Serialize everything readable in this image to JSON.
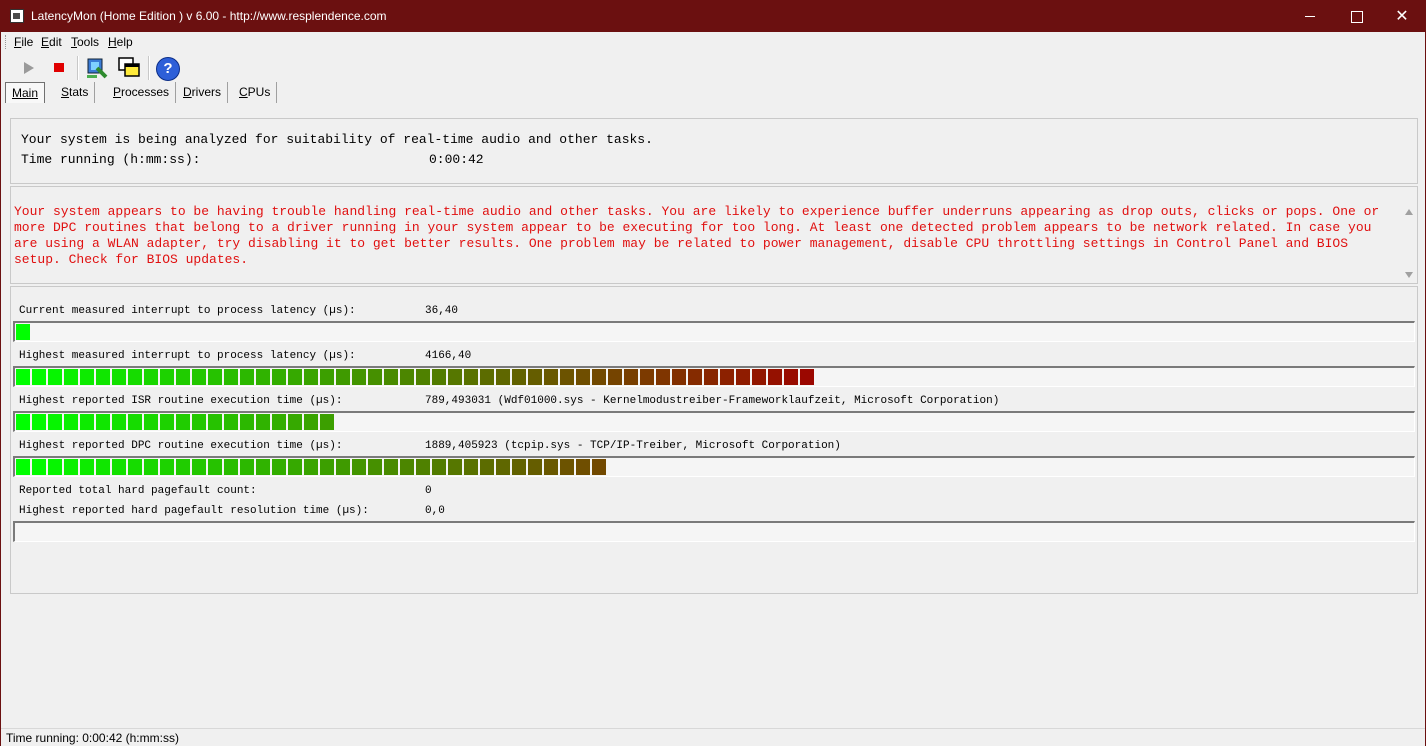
{
  "window": {
    "title": "LatencyMon  (Home Edition )  v 6.00 - http://www.resplendence.com"
  },
  "menu": [
    {
      "label": "File",
      "accel": "F",
      "rest": "ile"
    },
    {
      "label": "Edit",
      "accel": "E",
      "rest": "dit"
    },
    {
      "label": "Tools",
      "accel": "T",
      "rest": "ools"
    },
    {
      "label": "Help",
      "accel": "H",
      "rest": "elp"
    }
  ],
  "toolbar": {
    "icons": [
      "play-icon",
      "stop-icon",
      "cpu-icon",
      "windows-icon",
      "help-icon"
    ]
  },
  "tabs": [
    {
      "label": "Main",
      "accel": "M",
      "rest": "ain",
      "active": true
    },
    {
      "label": "Stats",
      "accel": "S",
      "rest": "tats",
      "active": false
    },
    {
      "label": "Processes",
      "accel": "P",
      "rest": "rocesses",
      "active": false
    },
    {
      "label": "Drivers",
      "accel": "D",
      "rest": "rivers",
      "active": false
    },
    {
      "label": "CPUs",
      "accel": "C",
      "rest": "PUs",
      "active": false
    }
  ],
  "status": {
    "analyzing": "Your system is being analyzed for suitability of real-time audio and other tasks.",
    "time_label": "Time running (h:mm:ss):",
    "time_value": "0:00:42"
  },
  "warning": {
    "text": "Your system appears to be having trouble handling real-time audio and other tasks. You are likely to experience buffer underruns appearing as drop outs, clicks or pops. One or more DPC routines that belong to a driver running in your system appear to be executing for too long. At least one detected problem appears to be network related. In case you are using a WLAN adapter, try disabling it to get better results. One problem may be related to power management, disable CPU throttling settings in Control Panel and BIOS setup. Check for BIOS updates.",
    "color": "#e01010"
  },
  "metrics": {
    "current": {
      "label": "Current measured interrupt to process latency (µs):",
      "value": "36,40",
      "bar_fraction": 0.0088
    },
    "highest": {
      "label": "Highest measured interrupt to process latency (µs):",
      "value": "4166,40",
      "bar_fraction": 0.58
    },
    "isr": {
      "label": "Highest reported ISR routine execution time (µs):",
      "value": "789,493031  (Wdf01000.sys - Kernelmodustreiber-Frameworklaufzeit, Microsoft Corporation)",
      "bar_fraction": 0.227
    },
    "dpc": {
      "label": "Highest reported DPC routine execution time (µs):",
      "value": "1889,405923  (tcpip.sys - TCP/IP-Treiber, Microsoft Corporation)",
      "bar_fraction": 0.42
    },
    "pagefault_count": {
      "label": "Reported total hard pagefault count:",
      "value": "0"
    },
    "pagefault_time": {
      "label": "Highest reported hard pagefault resolution time (µs):",
      "value": "0,0",
      "bar_fraction": 0
    }
  },
  "statusbar": {
    "text": "Time running: 0:00:42  (h:mm:ss)"
  },
  "colors": {
    "titlebar": "#6b1010",
    "bar_start": "#00ff00",
    "bar_end": "#a00000"
  }
}
